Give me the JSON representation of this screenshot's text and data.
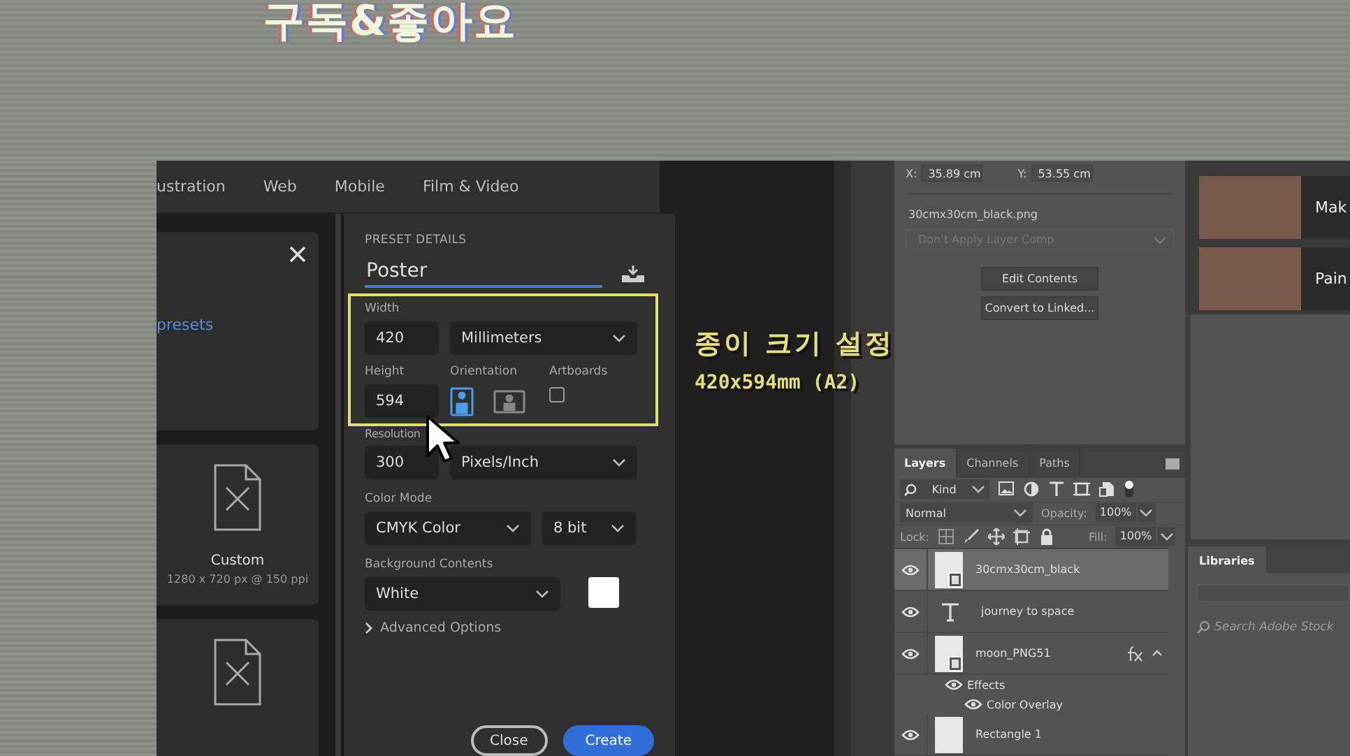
{
  "overlay": {
    "banner_text": "구독&좋아요",
    "caption": [
      "종이 크기 설정",
      "420x594mm (A2)"
    ]
  },
  "dialog": {
    "tabs": [
      {
        "label": "ustration",
        "selected": false
      },
      {
        "label": "Web",
        "selected": false
      },
      {
        "label": "Mobile",
        "selected": false
      },
      {
        "label": "Film & Video",
        "selected": false
      }
    ],
    "presets_link": "presets",
    "presets": [
      {
        "kind": "document",
        "name": "Custom",
        "detail": "1280 x 720 px @ 150 ppi"
      },
      {
        "kind": "document"
      }
    ],
    "details": {
      "heading": "PRESET DETAILS",
      "name": "Poster",
      "width": {
        "label": "Width",
        "value": "420",
        "unit": "Millimeters"
      },
      "height": {
        "label": "Height",
        "value": "594"
      },
      "orientation": {
        "label": "Orientation",
        "options": [
          {
            "kind": "portrait",
            "selected": true
          },
          {
            "kind": "landscape",
            "selected": false
          }
        ]
      },
      "artboards": {
        "label": "Artboards",
        "checked": false
      },
      "resolution": {
        "label": "Resolution",
        "value": "300",
        "unit": "Pixels/Inch"
      },
      "color_mode": {
        "label": "Color Mode",
        "value": "CMYK Color",
        "depth": "8 bit"
      },
      "background": {
        "label": "Background Contents",
        "value": "White"
      },
      "advanced": "Advanced Options",
      "buttons": [
        {
          "label": "Close",
          "kind": "secondary"
        },
        {
          "label": "Create",
          "kind": "primary"
        }
      ]
    }
  },
  "properties": {
    "x_label": "X:",
    "x": "35.89 cm",
    "y_label": "Y:",
    "y": "53.55 cm",
    "file": "30cmx30cm_black.png",
    "layer_comp": "Don't Apply Layer Comp",
    "buttons": [
      "Edit Contents",
      "Convert to Linked..."
    ]
  },
  "layers_panel": {
    "tabs": [
      {
        "label": "Layers",
        "selected": true
      },
      {
        "label": "Channels",
        "selected": false
      },
      {
        "label": "Paths",
        "selected": false
      }
    ],
    "filter": "Kind",
    "blend": "Normal",
    "opacity_label": "Opacity:",
    "opacity": "100%",
    "lock_label": "Lock:",
    "fill_label": "Fill:",
    "fill": "100%",
    "layers": [
      {
        "name": "30cmx30cm_black",
        "kind": "smart",
        "selected": true,
        "visible": true,
        "fx": false
      },
      {
        "name": "journey to space",
        "kind": "text",
        "selected": false,
        "visible": true,
        "fx": false
      },
      {
        "name": "moon_PNG51",
        "kind": "smart",
        "selected": false,
        "visible": true,
        "fx": true,
        "children": [
          {
            "name": "Effects",
            "visible": true,
            "children": [
              {
                "name": "Color Overlay",
                "visible": true
              }
            ]
          }
        ]
      },
      {
        "name": "Rectangle 1",
        "kind": "shape",
        "selected": false,
        "visible": true,
        "fx": false
      }
    ]
  },
  "learn": [
    {
      "title": "Mak"
    },
    {
      "title": "Pain"
    }
  ],
  "libraries": {
    "tab": "Libraries",
    "placeholder": "Search Adobe Stock"
  }
}
